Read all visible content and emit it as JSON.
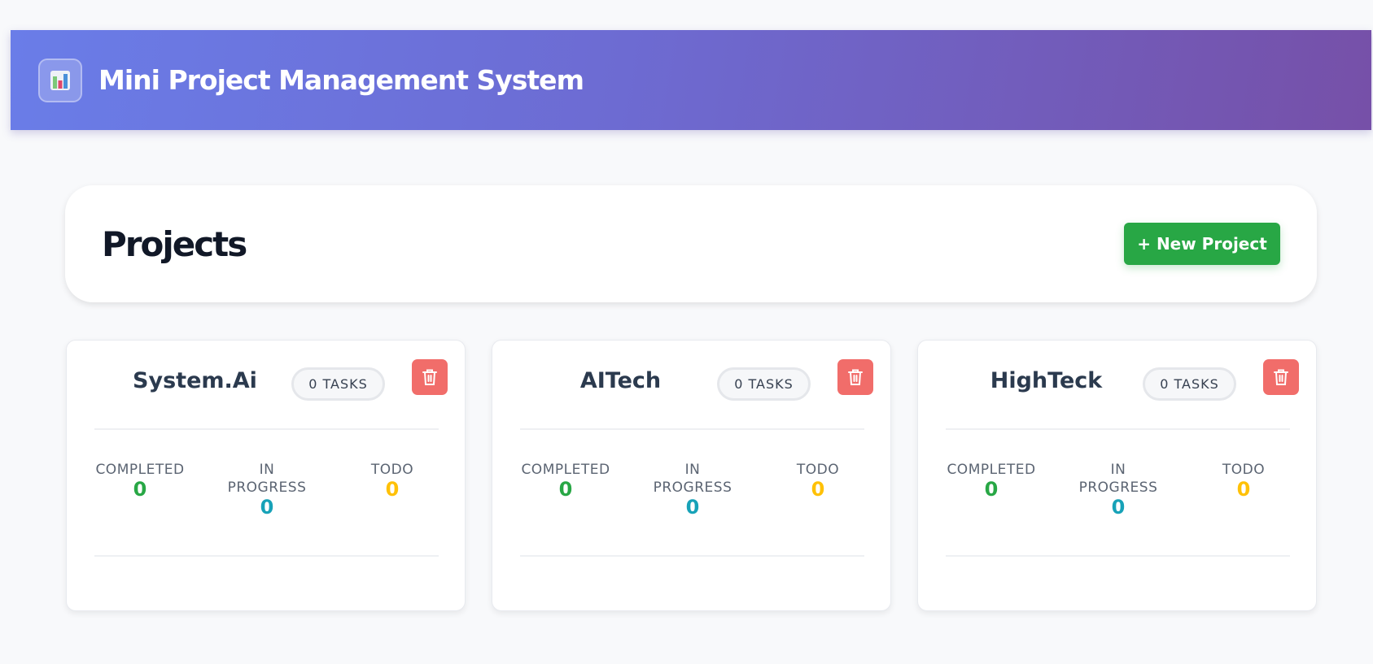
{
  "header": {
    "title": "Mini Project Management System",
    "logo_icon": "bar-chart-icon"
  },
  "main": {
    "title": "Projects",
    "new_project_label": "+ New Project"
  },
  "projects": [
    {
      "name": "System.Ai",
      "tasks_label": "0 TASKS",
      "completed_label": "COMPLETED",
      "completed": "0",
      "in_progress_label_1": "IN",
      "in_progress_label_2": "PROGRESS",
      "in_progress": "0",
      "todo_label": "TODO",
      "todo": "0"
    },
    {
      "name": "AITech",
      "tasks_label": "0 TASKS",
      "completed_label": "COMPLETED",
      "completed": "0",
      "in_progress_label_1": "IN",
      "in_progress_label_2": "PROGRESS",
      "in_progress": "0",
      "todo_label": "TODO",
      "todo": "0"
    },
    {
      "name": "HighTeck",
      "tasks_label": "0 TASKS",
      "completed_label": "COMPLETED",
      "completed": "0",
      "in_progress_label_1": "IN",
      "in_progress_label_2": "PROGRESS",
      "in_progress": "0",
      "todo_label": "TODO",
      "todo": "0"
    }
  ],
  "colors": {
    "completed": "#28a745",
    "in_progress": "#17a2b8",
    "todo": "#ffc107",
    "delete": "#f16d6a",
    "primary_button": "#28a745"
  }
}
